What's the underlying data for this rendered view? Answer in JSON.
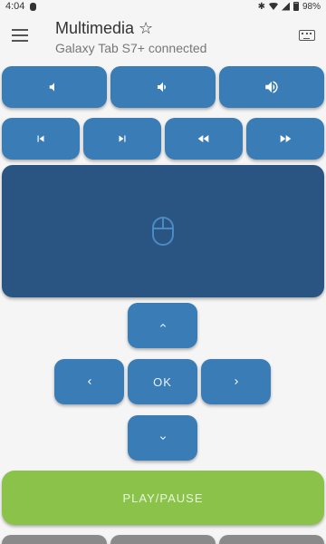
{
  "status_bar": {
    "time": "4:04",
    "battery": "98%"
  },
  "header": {
    "title": "Multimedia ☆",
    "subtitle": "Galaxy Tab S7+ connected"
  },
  "dpad": {
    "ok_label": "OK"
  },
  "play_pause": {
    "label": "PLAY/PAUSE"
  },
  "colors": {
    "button": "#3a7db6",
    "touchpad": "#2a5582",
    "play": "#8bc34a",
    "background": "#f5f5f5",
    "bottom_buttons": "#8a8a8a"
  },
  "icons": {
    "volume": [
      "volume-mute-icon",
      "volume-down-icon",
      "volume-up-icon"
    ],
    "media": [
      "skip-previous-icon",
      "skip-next-icon",
      "rewind-icon",
      "fast-forward-icon"
    ],
    "touchpad": "mouse-icon",
    "dpad": [
      "chevron-up-icon",
      "chevron-left-icon",
      "chevron-right-icon",
      "chevron-down-icon"
    ]
  }
}
